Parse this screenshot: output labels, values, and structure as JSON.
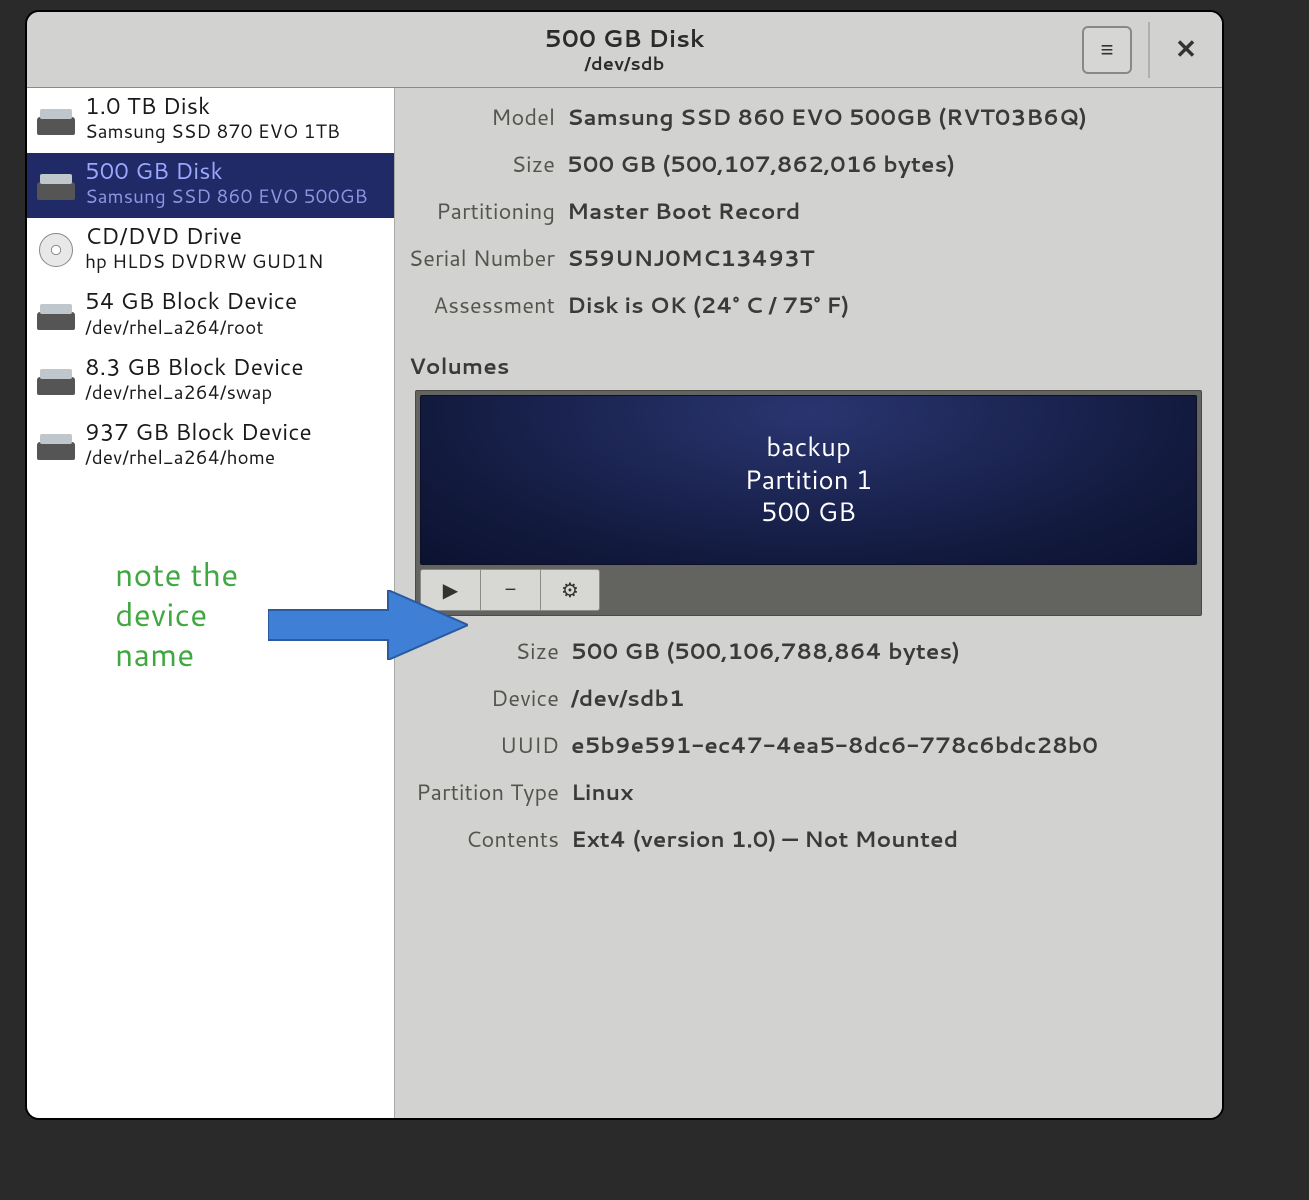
{
  "header": {
    "title": "500 GB Disk",
    "subtitle": "/dev/sdb"
  },
  "sidebar": {
    "drives": [
      {
        "name": "1.0 TB Disk",
        "sub": "Samsung SSD 870 EVO 1TB",
        "type": "hdd",
        "selected": false
      },
      {
        "name": "500 GB Disk",
        "sub": "Samsung SSD 860 EVO 500GB",
        "type": "hdd",
        "selected": true
      },
      {
        "name": "CD/DVD Drive",
        "sub": "hp HLDS DVDRW GUD1N",
        "type": "cd",
        "selected": false
      },
      {
        "name": "54 GB Block Device",
        "sub": "/dev/rhel_a264/root",
        "type": "hdd",
        "selected": false
      },
      {
        "name": "8.3 GB Block Device",
        "sub": "/dev/rhel_a264/swap",
        "type": "hdd",
        "selected": false
      },
      {
        "name": "937 GB Block Device",
        "sub": "/dev/rhel_a264/home",
        "type": "hdd",
        "selected": false
      }
    ]
  },
  "disk": {
    "model_label": "Model",
    "model": "Samsung SSD 860 EVO 500GB (RVT03B6Q)",
    "size_label": "Size",
    "size": "500 GB (500,107,862,016 bytes)",
    "partitioning_label": "Partitioning",
    "partitioning": "Master Boot Record",
    "serial_label": "Serial Number",
    "serial": "S59UNJ0MC13493T",
    "assessment_label": "Assessment",
    "assessment": "Disk is OK (24° C / 75° F)"
  },
  "volumes": {
    "heading": "Volumes",
    "partition": {
      "name": "backup",
      "label": "Partition 1",
      "size": "500 GB"
    },
    "details": {
      "size_label": "Size",
      "size": "500 GB (500,106,788,864 bytes)",
      "device_label": "Device",
      "device": "/dev/sdb1",
      "uuid_label": "UUID",
      "uuid": "e5b9e591-ec47-4ea5-8dc6-778c6bdc28b0",
      "ptype_label": "Partition Type",
      "ptype": "Linux",
      "contents_label": "Contents",
      "contents": "Ext4 (version 1.0) — Not Mounted"
    }
  },
  "annotation": {
    "line1": "note the",
    "line2": "device",
    "line3": "name"
  },
  "icons": {
    "menu": "≡",
    "close": "✕",
    "play": "▶",
    "minus": "−",
    "gear": "⚙"
  }
}
